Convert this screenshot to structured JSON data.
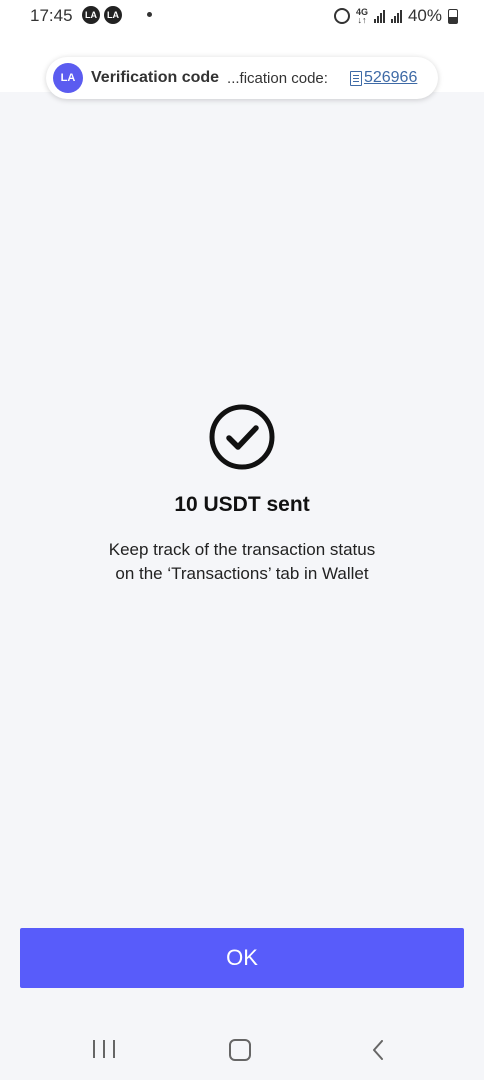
{
  "status_bar": {
    "time": "17:45",
    "app_badge_1": "LA",
    "app_badge_2": "LA",
    "network_type_top": "4G",
    "battery_percent": "40%"
  },
  "notification": {
    "app_badge": "LA",
    "title": "Verification code",
    "body": "...fication code:",
    "code": "526966"
  },
  "result": {
    "icon": "check-circle-icon",
    "title": "10 USDT sent",
    "description_line_1": "Keep track of the transaction status",
    "description_line_2": "on the ‘Transactions’ tab in Wallet"
  },
  "actions": {
    "ok_label": "OK"
  },
  "colors": {
    "accent": "#585cfa",
    "background": "#f5f6f9",
    "link": "#3e6aa6"
  },
  "nav": {
    "recent_icon": "recent-apps-icon",
    "home_icon": "home-icon",
    "back_icon": "back-icon"
  }
}
